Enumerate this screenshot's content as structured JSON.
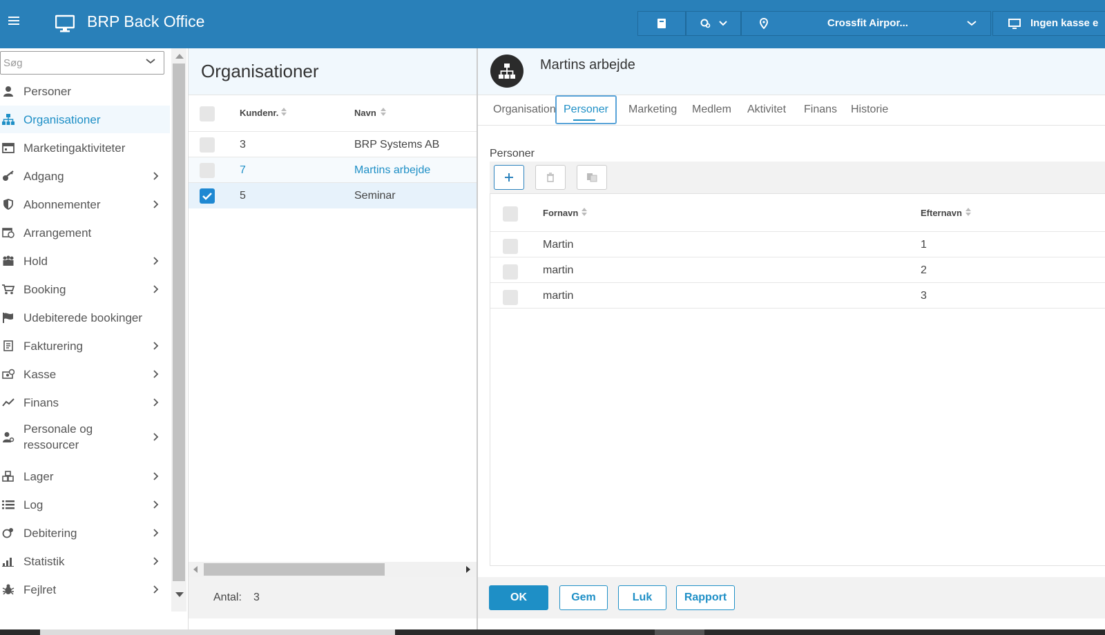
{
  "app": {
    "title": "BRP Back Office"
  },
  "topbar": {
    "location": "Crossfit Airpor...",
    "register": "Ingen kasse e"
  },
  "sidebar": {
    "search_placeholder": "Søg",
    "items": [
      {
        "label": "Personer",
        "icon": "person-icon",
        "chevron": false
      },
      {
        "label": "Organisationer",
        "icon": "org-chart-icon",
        "chevron": false,
        "active": true
      },
      {
        "label": "Marketingaktiviteter",
        "icon": "calendar-icon",
        "chevron": false
      },
      {
        "label": "Adgang",
        "icon": "key-icon",
        "chevron": true
      },
      {
        "label": "Abonnementer",
        "icon": "shield-icon",
        "chevron": true
      },
      {
        "label": "Arrangement",
        "icon": "calendar-clock-icon",
        "chevron": false
      },
      {
        "label": "Hold",
        "icon": "group-icon",
        "chevron": true
      },
      {
        "label": "Booking",
        "icon": "cart-icon",
        "chevron": true
      },
      {
        "label": "Udebiterede bookinger",
        "icon": "flag-icon",
        "chevron": false
      },
      {
        "label": "Fakturering",
        "icon": "invoice-icon",
        "chevron": true
      },
      {
        "label": "Kasse",
        "icon": "cash-icon",
        "chevron": true
      },
      {
        "label": "Finans",
        "icon": "trend-icon",
        "chevron": true
      },
      {
        "label": "Personale og ressourcer",
        "icon": "staff-icon",
        "chevron": true
      },
      {
        "label": "Lager",
        "icon": "boxes-icon",
        "chevron": true
      },
      {
        "label": "Log",
        "icon": "list-icon",
        "chevron": true
      },
      {
        "label": "Debitering",
        "icon": "debit-icon",
        "chevron": true
      },
      {
        "label": "Statistik",
        "icon": "bar-chart-icon",
        "chevron": true
      },
      {
        "label": "Fejlret",
        "icon": "bug-icon",
        "chevron": true
      }
    ]
  },
  "organisations": {
    "title": "Organisationer",
    "columns": {
      "number": "Kundenr.",
      "name": "Navn"
    },
    "rows": [
      {
        "number": "3",
        "name": "BRP Systems AB",
        "checked": false,
        "state": "normal"
      },
      {
        "number": "7",
        "name": "Martins arbejde",
        "checked": false,
        "state": "open"
      },
      {
        "number": "5",
        "name": "Seminar",
        "checked": true,
        "state": "selected"
      }
    ],
    "footer": {
      "count_label": "Antal:",
      "count_value": "3"
    }
  },
  "detail": {
    "title": "Martins arbejde",
    "tabs": [
      "Organisation",
      "Personer",
      "Marketing",
      "Medlem",
      "Aktivitet",
      "Finans",
      "Historie"
    ],
    "active_tab": "Personer",
    "section_label": "Personer",
    "columns": {
      "first": "Fornavn",
      "last": "Efternavn"
    },
    "rows": [
      {
        "first": "Martin",
        "last": "1"
      },
      {
        "first": "martin",
        "last": "2"
      },
      {
        "first": "martin",
        "last": "3"
      }
    ],
    "buttons": {
      "ok": "OK",
      "save": "Gem",
      "close": "Luk",
      "report": "Rapport"
    }
  },
  "colors": {
    "brand": "#2980b9",
    "accent": "#1e8fc6",
    "active_bg": "#f1f8fd"
  }
}
